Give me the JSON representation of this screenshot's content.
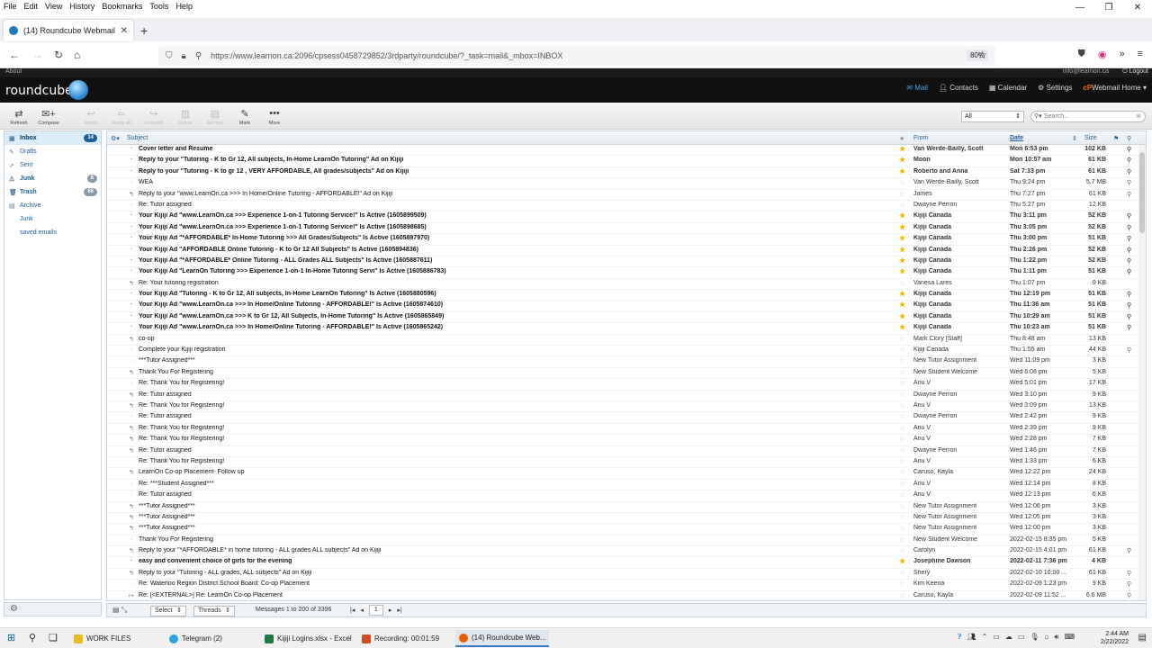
{
  "browser": {
    "menu": [
      "File",
      "Edit",
      "View",
      "History",
      "Bookmarks",
      "Tools",
      "Help"
    ],
    "tab_title": "(14) Roundcube Webmail :: Inb",
    "url": "https://www.learnon.ca:2096/cpsess0458729852/3rdparty/roundcube/?_task=mail&_mbox=INBOX",
    "zoom": "80%"
  },
  "rc": {
    "about": "About",
    "user": "info@learnon.ca",
    "logout": "Logout",
    "logo": "roundcube",
    "nav": [
      "Mail",
      "Contacts",
      "Calendar",
      "Settings",
      "Webmail Home"
    ],
    "toolbar": [
      "Refresh",
      "Compose",
      "Reply",
      "Reply all",
      "Forward",
      "Delete",
      "Archive",
      "Mark",
      "More"
    ],
    "filter": "All",
    "search_placeholder": "Search..."
  },
  "folders": [
    {
      "name": "Inbox",
      "count": "14",
      "icon": "inbox-icon"
    },
    {
      "name": "Drafts",
      "count": "",
      "icon": "pencil-icon"
    },
    {
      "name": "Sent",
      "count": "",
      "icon": "sent-icon"
    },
    {
      "name": "Junk",
      "count": "8",
      "icon": "junk-icon"
    },
    {
      "name": "Trash",
      "count": "66",
      "icon": "trash-icon"
    },
    {
      "name": "Archive",
      "count": "",
      "icon": "archive-icon"
    },
    {
      "name": "Junk",
      "count": "",
      "icon": "folder-icon"
    },
    {
      "name": "saved emails",
      "count": "",
      "icon": "folder-icon"
    }
  ],
  "list_header": {
    "subject": "Subject",
    "from": "From",
    "date": "Date",
    "size": "Size"
  },
  "messages": [
    {
      "subject": "Cover letter and Resume",
      "from": "Van Werde-Bailly, Scott",
      "date": "Mon 6:53 pm",
      "size": "102 KB",
      "unread": true,
      "flag": true,
      "att": true,
      "ico": ""
    },
    {
      "subject": "Reply to your \"Tutoring - K to Gr 12, All subjects, In-Home LearnOn Tutoring\" Ad on Kijiji",
      "from": "Moon",
      "date": "Mon 10:57 am",
      "size": "61 KB",
      "unread": true,
      "flag": true,
      "att": true,
      "ico": ""
    },
    {
      "subject": "Reply to your \"Tutoring - K to gr 12 , VERY AFFORDABLE, All grades/subjects\" Ad on Kijiji",
      "from": "Roberto and Anna",
      "date": "Sat 7:33 pm",
      "size": "61 KB",
      "unread": true,
      "flag": true,
      "att": true,
      "ico": ""
    },
    {
      "subject": "WEA",
      "from": "Van Werde-Bailly, Scott",
      "date": "Thu 9:24 pm",
      "size": "5.7 MB",
      "unread": false,
      "flag": false,
      "att": true,
      "ico": ""
    },
    {
      "subject": "Reply to your \"www.LearnOn.ca >>> In Home/Online Tutoring - AFFORDABLE!\" Ad on Kijiji",
      "from": "James",
      "date": "Thu 7:27 pm",
      "size": "61 KB",
      "unread": false,
      "flag": false,
      "att": true,
      "ico": "↰"
    },
    {
      "subject": "Re: Tutor assigned",
      "from": "Dwayne Perron",
      "date": "Thu 5:27 pm",
      "size": "12 KB",
      "unread": false,
      "flag": false,
      "att": false,
      "ico": ""
    },
    {
      "subject": "Your Kijiji Ad \"www.LearnOn.ca >>> Experience 1-on-1 Tutoring Service!\" Is Active (1605899509)",
      "from": "Kijiji Canada",
      "date": "Thu 3:11 pm",
      "size": "52 KB",
      "unread": true,
      "flag": true,
      "att": true,
      "ico": ""
    },
    {
      "subject": "Your Kijiji Ad \"www.LearnOn.ca >>> Experience 1-on-1 Tutoring Service!\" Is Active (1605898685)",
      "from": "Kijiji Canada",
      "date": "Thu 3:05 pm",
      "size": "52 KB",
      "unread": true,
      "flag": true,
      "att": true,
      "ico": ""
    },
    {
      "subject": "Your Kijiji Ad \"*AFFORDABLE* In-Home Tutoring >>> All Grades/Subjects\" Is Active (1605897970)",
      "from": "Kijiji Canada",
      "date": "Thu 3:00 pm",
      "size": "51 KB",
      "unread": true,
      "flag": true,
      "att": true,
      "ico": ""
    },
    {
      "subject": "Your Kijiji Ad \"AFFORDABLE Online Tutoring - K to Gr 12 All Subjects\" Is Active (1605894836)",
      "from": "Kijiji Canada",
      "date": "Thu 2:26 pm",
      "size": "52 KB",
      "unread": true,
      "flag": true,
      "att": true,
      "ico": ""
    },
    {
      "subject": "Your Kijiji Ad \"*AFFORDABLE* Online Tutoring - ALL Grades ALL Subjects\" Is Active (1605887611)",
      "from": "Kijiji Canada",
      "date": "Thu 1:22 pm",
      "size": "52 KB",
      "unread": true,
      "flag": true,
      "att": true,
      "ico": ""
    },
    {
      "subject": "Your Kijiji Ad \"LearnOn Tutoring >>> Experience 1-on-1 In-Home Tutoring Servi\" Is Active (1605886783)",
      "from": "Kijiji Canada",
      "date": "Thu 1:11 pm",
      "size": "51 KB",
      "unread": true,
      "flag": true,
      "att": true,
      "ico": ""
    },
    {
      "subject": "Re: Your tutoring registration",
      "from": "Vanesa Lares",
      "date": "Thu 1:07 pm",
      "size": "9 KB",
      "unread": false,
      "flag": false,
      "att": false,
      "ico": "↰"
    },
    {
      "subject": "Your Kijiji Ad \"Tutoring - K to Gr 12, All subjects, In-Home LearnOn Tutoring\" Is Active (1605880596)",
      "from": "Kijiji Canada",
      "date": "Thu 12:19 pm",
      "size": "51 KB",
      "unread": true,
      "flag": true,
      "att": true,
      "ico": ""
    },
    {
      "subject": "Your Kijiji Ad \"www.LearnOn.ca >>> In Home/Online Tutoring - AFFORDABLE!\" Is Active (1605874610)",
      "from": "Kijiji Canada",
      "date": "Thu 11:36 am",
      "size": "51 KB",
      "unread": true,
      "flag": true,
      "att": true,
      "ico": ""
    },
    {
      "subject": "Your Kijiji Ad \"www.LearnOn.ca >>> K to Gr 12, All Subjects, In-Home Tutoring\" Is Active (1605865849)",
      "from": "Kijiji Canada",
      "date": "Thu 10:29 am",
      "size": "51 KB",
      "unread": true,
      "flag": true,
      "att": true,
      "ico": ""
    },
    {
      "subject": "Your Kijiji Ad \"www.LearnOn.ca >>> In Home/Online Tutoring - AFFORDABLE!\" Is Active (1605865242)",
      "from": "Kijiji Canada",
      "date": "Thu 10:23 am",
      "size": "51 KB",
      "unread": true,
      "flag": true,
      "att": true,
      "ico": ""
    },
    {
      "subject": "co-op",
      "from": "Mark Clory [Staff]",
      "date": "Thu 8:48 am",
      "size": "13 KB",
      "unread": false,
      "flag": false,
      "att": false,
      "ico": "↰"
    },
    {
      "subject": "Complete your Kijiji registration",
      "from": "Kijiji Canada",
      "date": "Thu 1:55 am",
      "size": "44 KB",
      "unread": false,
      "flag": false,
      "att": true,
      "ico": ""
    },
    {
      "subject": "***Tutor Assigned***",
      "from": "New Tutor Assignment",
      "date": "Wed 11:09 pm",
      "size": "3 KB",
      "unread": false,
      "flag": false,
      "att": false,
      "ico": ""
    },
    {
      "subject": "Thank You For Registering",
      "from": "New Student Welcome",
      "date": "Wed 6:08 pm",
      "size": "5 KB",
      "unread": false,
      "flag": false,
      "att": false,
      "ico": "↰"
    },
    {
      "subject": "Re: Thank You for Registering!",
      "from": "Anu V",
      "date": "Wed 5:01 pm",
      "size": "17 KB",
      "unread": false,
      "flag": false,
      "att": false,
      "ico": ""
    },
    {
      "subject": "Re: Tutor assigned",
      "from": "Dwayne Perron",
      "date": "Wed 3:10 pm",
      "size": "9 KB",
      "unread": false,
      "flag": false,
      "att": false,
      "ico": "↰"
    },
    {
      "subject": "Re: Thank You for Registering!",
      "from": "Anu V",
      "date": "Wed 3:09 pm",
      "size": "13 KB",
      "unread": false,
      "flag": false,
      "att": false,
      "ico": "↰"
    },
    {
      "subject": "Re: Tutor assigned",
      "from": "Dwayne Perron",
      "date": "Wed 2:42 pm",
      "size": "9 KB",
      "unread": false,
      "flag": false,
      "att": false,
      "ico": ""
    },
    {
      "subject": "Re: Thank You for Registering!",
      "from": "Anu V",
      "date": "Wed 2:39 pm",
      "size": "9 KB",
      "unread": false,
      "flag": false,
      "att": false,
      "ico": "↰"
    },
    {
      "subject": "Re: Thank You for Registering!",
      "from": "Anu V",
      "date": "Wed 2:28 pm",
      "size": "7 KB",
      "unread": false,
      "flag": false,
      "att": false,
      "ico": "↰"
    },
    {
      "subject": "Re: Tutor assigned",
      "from": "Dwayne Perron",
      "date": "Wed 1:46 pm",
      "size": "7 KB",
      "unread": false,
      "flag": false,
      "att": false,
      "ico": "↰"
    },
    {
      "subject": "Re: Thank You for Registering!",
      "from": "Anu V",
      "date": "Wed 1:33 pm",
      "size": "6 KB",
      "unread": false,
      "flag": false,
      "att": false,
      "ico": ""
    },
    {
      "subject": "LearnOn Co-op Placement- Follow up",
      "from": "Caruso, Kayla",
      "date": "Wed 12:22 pm",
      "size": "24 KB",
      "unread": false,
      "flag": false,
      "att": false,
      "ico": "↰"
    },
    {
      "subject": "Re: ***Student Assigned***",
      "from": "Anu V",
      "date": "Wed 12:14 pm",
      "size": "8 KB",
      "unread": false,
      "flag": false,
      "att": false,
      "ico": ""
    },
    {
      "subject": "Re: Tutor assigned",
      "from": "Anu V",
      "date": "Wed 12:13 pm",
      "size": "6 KB",
      "unread": false,
      "flag": false,
      "att": false,
      "ico": ""
    },
    {
      "subject": "***Tutor Assigned***",
      "from": "New Tutor Assignment",
      "date": "Wed 12:06 pm",
      "size": "3 KB",
      "unread": false,
      "flag": false,
      "att": false,
      "ico": "↰"
    },
    {
      "subject": "***Tutor Assigned***",
      "from": "New Tutor Assignment",
      "date": "Wed 12:05 pm",
      "size": "3 KB",
      "unread": false,
      "flag": false,
      "att": false,
      "ico": "↰"
    },
    {
      "subject": "***Tutor Assigned***",
      "from": "New Tutor Assignment",
      "date": "Wed 12:00 pm",
      "size": "3 KB",
      "unread": false,
      "flag": false,
      "att": false,
      "ico": "↰"
    },
    {
      "subject": "Thank You For Registering",
      "from": "New Student Welcome",
      "date": "2022-02-15 8:35 pm",
      "size": "5 KB",
      "unread": false,
      "flag": false,
      "att": false,
      "ico": ""
    },
    {
      "subject": "Reply to your \"*AFFORDABLE* in home tutoring - ALL grades ALL subjects\" Ad on Kijiji",
      "from": "Carolyn",
      "date": "2022-02-15 4:01 pm",
      "size": "61 KB",
      "unread": false,
      "flag": false,
      "att": true,
      "ico": "↰"
    },
    {
      "subject": "easy and convenient choice of girls for the evening",
      "from": "Josephine Dawson",
      "date": "2022-02-11 7:36 pm",
      "size": "4 KB",
      "unread": true,
      "flag": true,
      "att": false,
      "ico": ""
    },
    {
      "subject": "Reply to your \"Tutoring - ALL grades, ALL subjects\" Ad on Kijiji",
      "from": "Shery",
      "date": "2022-02-10 10:00 ...",
      "size": "61 KB",
      "unread": false,
      "flag": false,
      "att": true,
      "ico": "↰"
    },
    {
      "subject": "Re: Waterloo Region District School Board: Co-op Placement",
      "from": "Kim Keena",
      "date": "2022-02-09 1:23 pm",
      "size": "9 KB",
      "unread": false,
      "flag": false,
      "att": true,
      "ico": ""
    },
    {
      "subject": "Re: [<EXTERNAL>] Re: LearnOn Co-op Placement",
      "from": "Caruso, Kayla",
      "date": "2022-02-09 11:52 ...",
      "size": "6.6 MB",
      "unread": false,
      "flag": false,
      "att": true,
      "ico": "↦"
    }
  ],
  "footer": {
    "select": "Select",
    "threads": "Threads",
    "messages_count": "Messages 1 to 200 of 3396",
    "page": "1"
  },
  "taskbar": {
    "apps": [
      {
        "label": "WORK FILES",
        "color": "#e8b923"
      },
      {
        "label": "Telegram (2)",
        "color": "#2aa3df"
      },
      {
        "label": "Kijiji Logins.xlsx - Excel",
        "color": "#1f7a44"
      },
      {
        "label": "Recording:   00:01:59",
        "color": "#d04a1f"
      },
      {
        "label": "(14) Roundcube Web...",
        "color": "#e66000"
      }
    ],
    "time": "2:44 AM",
    "date": "2/22/2022"
  }
}
